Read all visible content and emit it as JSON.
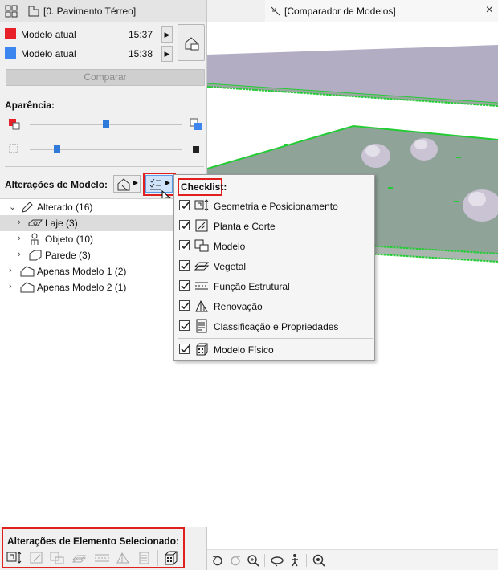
{
  "tabs": {
    "left": "[0. Pavimento Térreo]",
    "right": "[Comparador de Modelos]",
    "close": "×"
  },
  "models": {
    "current_a": {
      "label": "Modelo atual",
      "time": "15:37",
      "color": "#e8202a"
    },
    "current_b": {
      "label": "Modelo atual",
      "time": "15:38",
      "color": "#3d86f0"
    }
  },
  "compare_button": "Comparar",
  "appearance": {
    "title": "Aparência",
    "slider1_value": 0.5,
    "slider2_value": 0.18
  },
  "model_changes": {
    "title": "Alterações de Modelo:",
    "tree": [
      {
        "label": "Alterado (16)",
        "icon": "pencil-icon",
        "level": 0,
        "expanded": true
      },
      {
        "label": "Laje (3)",
        "icon": "slab-icon",
        "level": 1,
        "expanded": false,
        "selected": true
      },
      {
        "label": "Objeto (10)",
        "icon": "object-icon",
        "level": 1,
        "expanded": false
      },
      {
        "label": "Parede (3)",
        "icon": "wall-icon",
        "level": 1,
        "expanded": false
      },
      {
        "label": "Apenas Modelo 1 (2)",
        "icon": "house-icon",
        "level": 0,
        "expanded": false
      },
      {
        "label": "Apenas Modelo 2 (1)",
        "icon": "house-icon",
        "level": 0,
        "expanded": false
      }
    ]
  },
  "checklist": {
    "title": "Checklist:",
    "items": [
      {
        "label": "Geometria e Posicionamento",
        "checked": true,
        "icon": "geometry-icon"
      },
      {
        "label": "Planta e Corte",
        "checked": true,
        "icon": "plan-section-icon"
      },
      {
        "label": "Modelo",
        "checked": true,
        "icon": "model-icon"
      },
      {
        "label": "Vegetal",
        "checked": true,
        "icon": "vegetal-icon"
      },
      {
        "label": "Função Estrutural",
        "checked": true,
        "icon": "structural-icon"
      },
      {
        "label": "Renovação",
        "checked": true,
        "icon": "renovation-icon"
      },
      {
        "label": "Classificação e Propriedades",
        "checked": true,
        "icon": "properties-icon"
      },
      {
        "label": "Modelo Físico",
        "checked": true,
        "icon": "physical-model-icon"
      }
    ]
  },
  "selected_element_changes": {
    "title": "Alterações de Elemento Selecionado:"
  },
  "colors": {
    "highlight_red": "#e01f1f",
    "slab_top": "#8fa398",
    "edge_green": "#22cc33"
  }
}
